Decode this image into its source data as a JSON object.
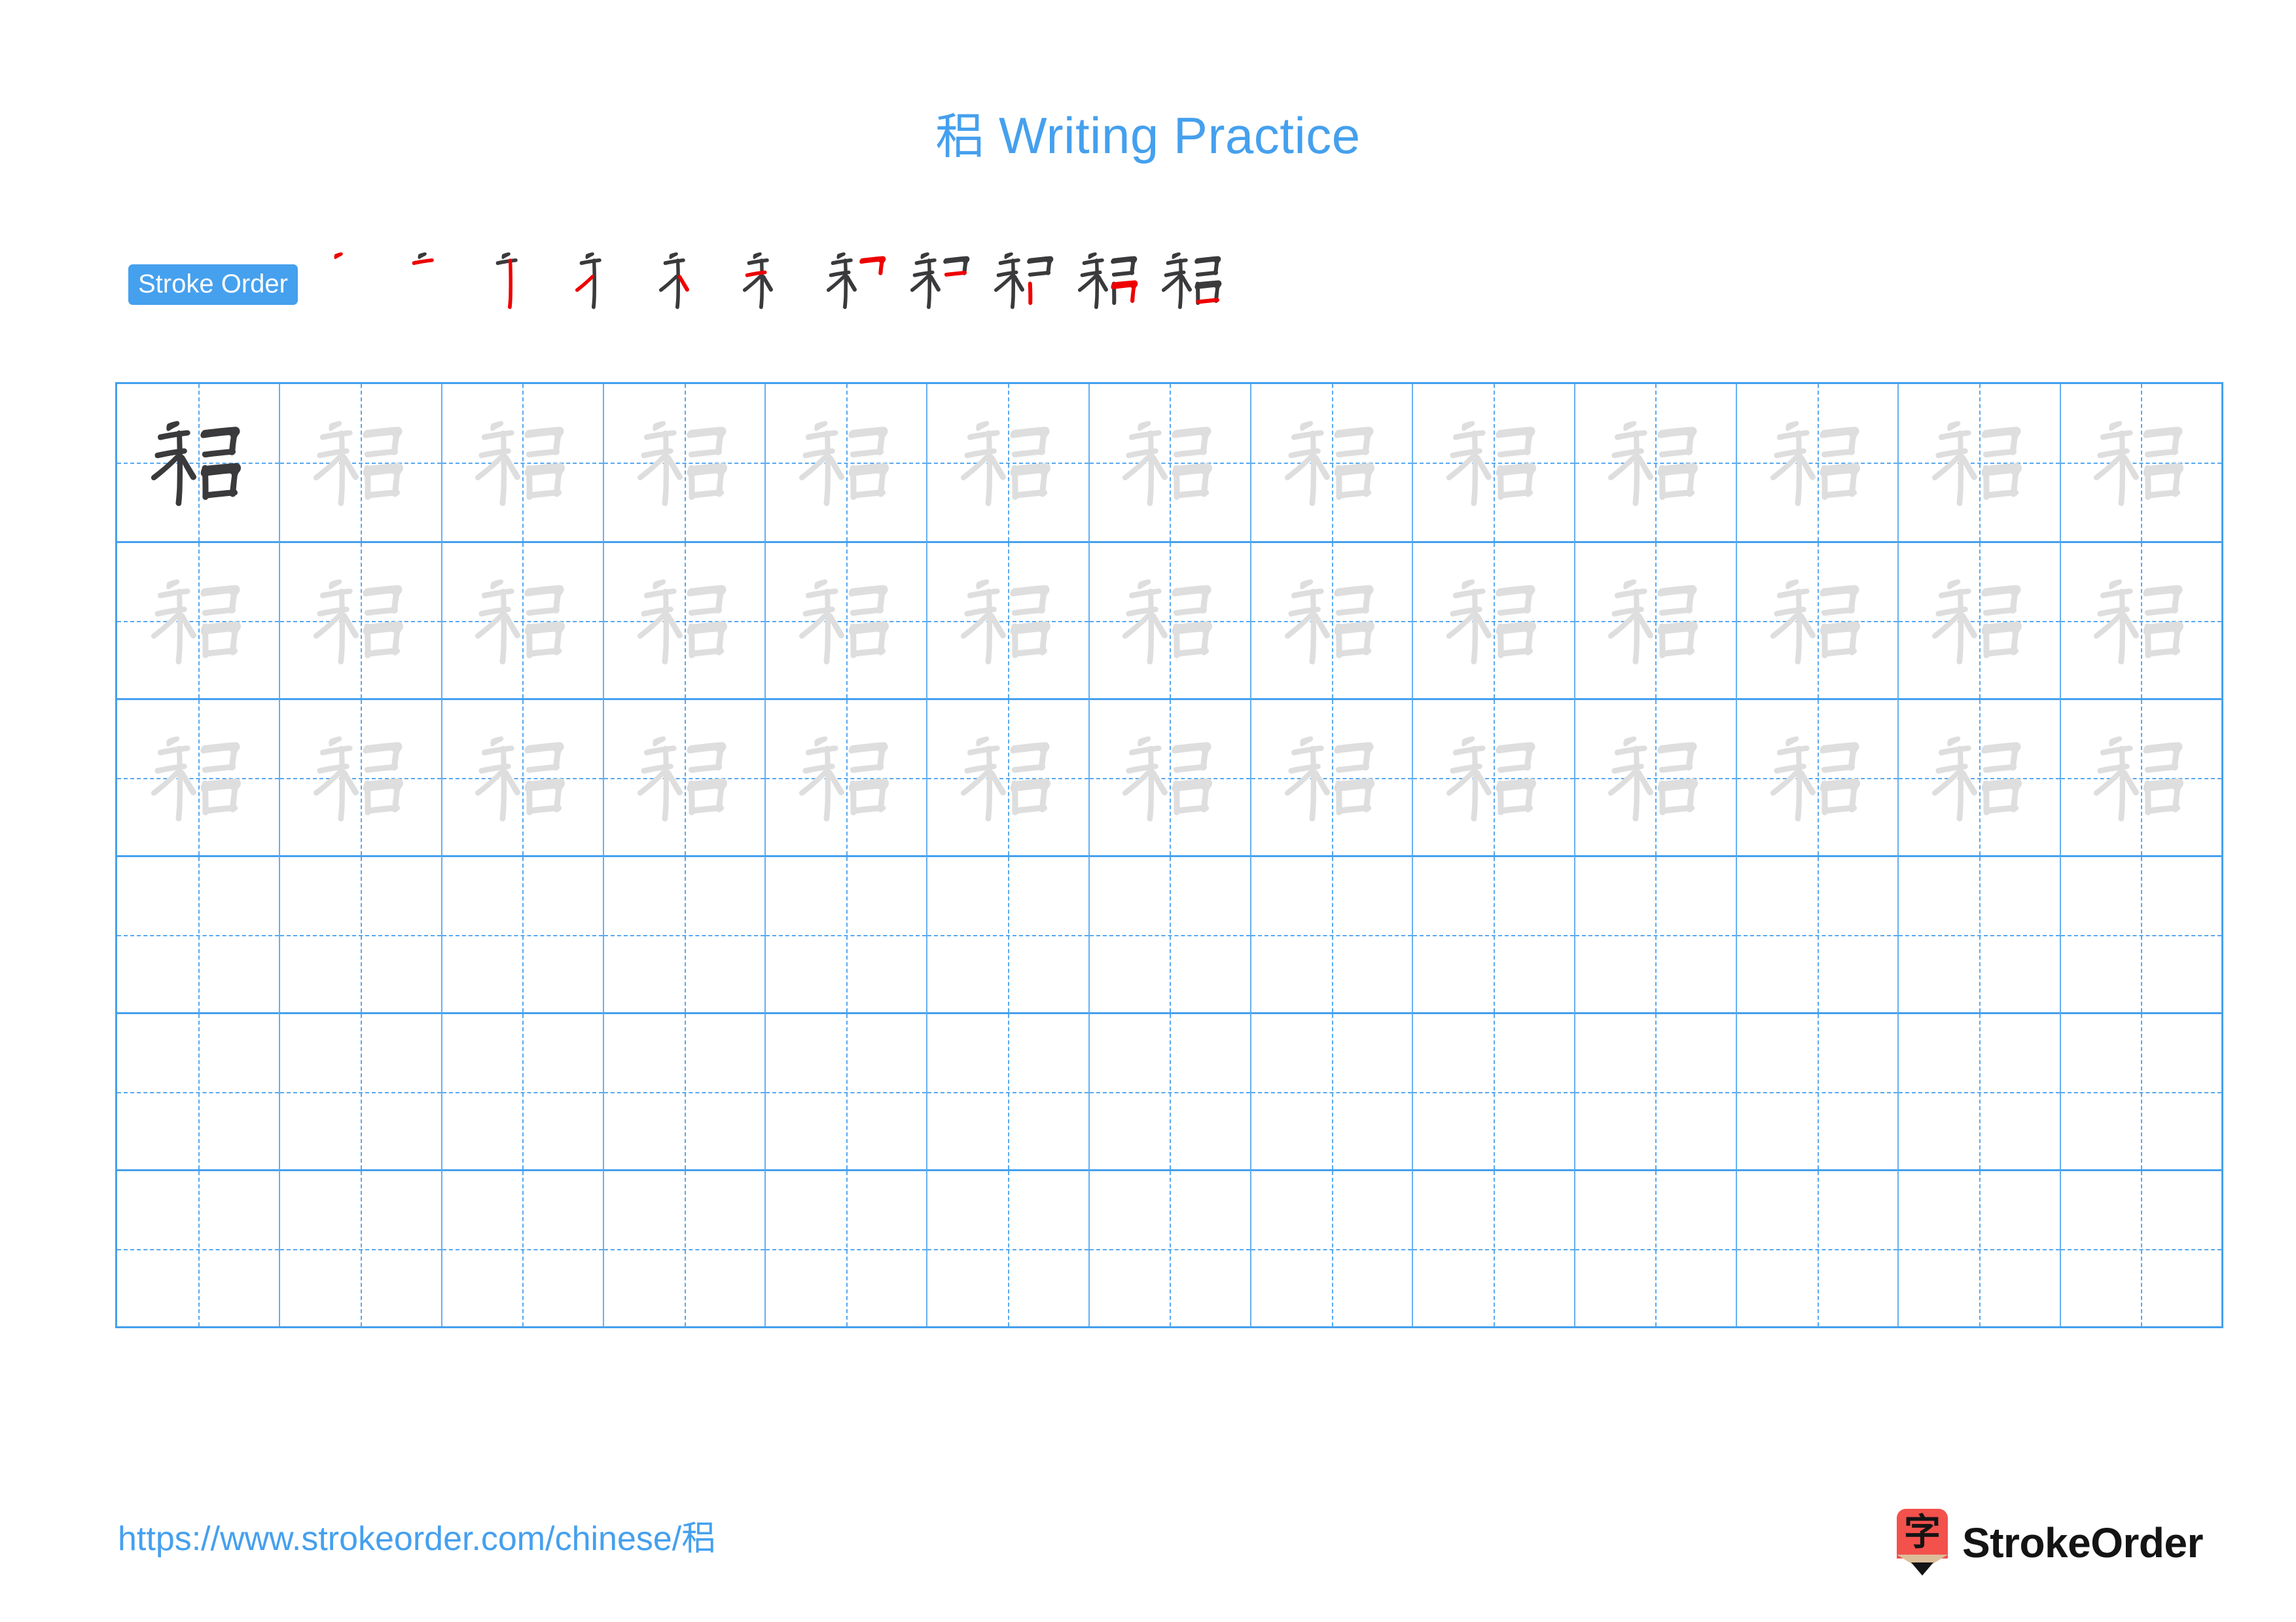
{
  "character": "稆",
  "colors": {
    "accent_blue": "#45A0EE",
    "grid_line": "#45A0EE",
    "grid_dash": "#57A8F0",
    "reference_char": "#3A3A3C",
    "trace_char": "#DEDEDE",
    "stroke_done": "#3A3A3C",
    "stroke_new": "#EE0000",
    "logo_red": "#F2514C",
    "logo_wood": "#DCBD99",
    "logo_black": "#141414"
  },
  "header": {
    "title_character": "稆",
    "title_text": " Writing Practice"
  },
  "stroke_order": {
    "badge_label": "Stroke Order",
    "stroke_count": 11,
    "steps": [
      {
        "index": 1,
        "new_stroke": "撇 (pie)"
      },
      {
        "index": 2,
        "new_stroke": "横 (heng)"
      },
      {
        "index": 3,
        "new_stroke": "竖 (shu)"
      },
      {
        "index": 4,
        "new_stroke": "撇 (pie)"
      },
      {
        "index": 5,
        "new_stroke": "捺 (na)"
      },
      {
        "index": 6,
        "new_stroke": "点 (dian)"
      },
      {
        "index": 7,
        "new_stroke": "横折 (heng-zhe)"
      },
      {
        "index": 8,
        "new_stroke": "横 (heng)"
      },
      {
        "index": 9,
        "new_stroke": "竖 (shu)"
      },
      {
        "index": 10,
        "new_stroke": "横折 (heng-zhe)"
      },
      {
        "index": 11,
        "new_stroke": "横 (heng)"
      }
    ]
  },
  "practice_grid": {
    "columns": 13,
    "rows": 6,
    "cells": [
      [
        "dark",
        "trace",
        "trace",
        "trace",
        "trace",
        "trace",
        "trace",
        "trace",
        "trace",
        "trace",
        "trace",
        "trace",
        "trace"
      ],
      [
        "trace",
        "trace",
        "trace",
        "trace",
        "trace",
        "trace",
        "trace",
        "trace",
        "trace",
        "trace",
        "trace",
        "trace",
        "trace"
      ],
      [
        "trace",
        "trace",
        "trace",
        "trace",
        "trace",
        "trace",
        "trace",
        "trace",
        "trace",
        "trace",
        "trace",
        "trace",
        "trace"
      ],
      [
        "empty",
        "empty",
        "empty",
        "empty",
        "empty",
        "empty",
        "empty",
        "empty",
        "empty",
        "empty",
        "empty",
        "empty",
        "empty"
      ],
      [
        "empty",
        "empty",
        "empty",
        "empty",
        "empty",
        "empty",
        "empty",
        "empty",
        "empty",
        "empty",
        "empty",
        "empty",
        "empty"
      ],
      [
        "empty",
        "empty",
        "empty",
        "empty",
        "empty",
        "empty",
        "empty",
        "empty",
        "empty",
        "empty",
        "empty",
        "empty",
        "empty"
      ]
    ]
  },
  "footer": {
    "url_prefix": "https://www.strokeorder.com/chinese/",
    "url_character": "稆",
    "logo_glyph": "字",
    "logo_text": "StrokeOrder"
  }
}
